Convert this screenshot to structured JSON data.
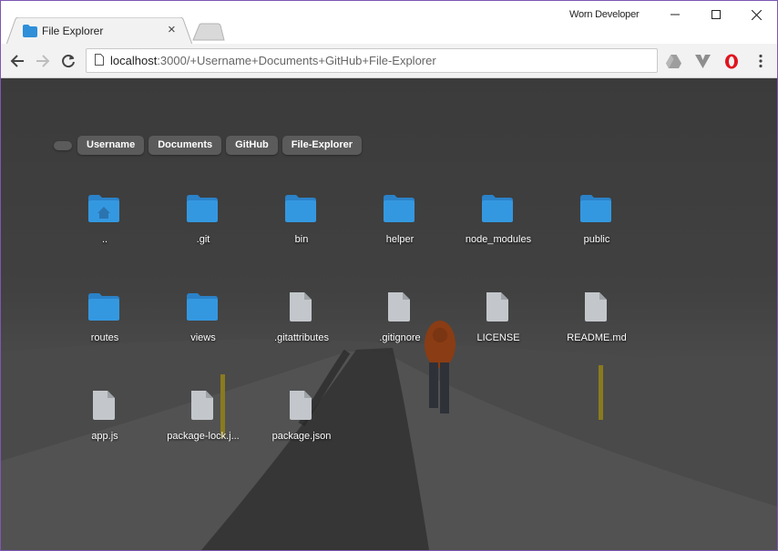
{
  "browser": {
    "tab_title": "File Explorer",
    "tab_close": "×",
    "profile_name": "Worn Developer",
    "url_host": "localhost",
    "url_rest": ":3000/+Username+Documents+GitHub+File-Explorer",
    "accent_color": "#2f8fd8"
  },
  "breadcrumb": {
    "root_label": "",
    "items": [
      "Username",
      "Documents",
      "GitHub",
      "File-Explorer"
    ]
  },
  "files": [
    {
      "name": "..",
      "type": "folder-home"
    },
    {
      "name": ".git",
      "type": "folder"
    },
    {
      "name": "bin",
      "type": "folder"
    },
    {
      "name": "helper",
      "type": "folder"
    },
    {
      "name": "node_modules",
      "type": "folder"
    },
    {
      "name": "public",
      "type": "folder"
    },
    {
      "name": "routes",
      "type": "folder"
    },
    {
      "name": "views",
      "type": "folder"
    },
    {
      "name": ".gitattributes",
      "type": "file"
    },
    {
      "name": ".gitignore",
      "type": "file"
    },
    {
      "name": "LICENSE",
      "type": "file"
    },
    {
      "name": "README.md",
      "type": "file"
    },
    {
      "name": "app.js",
      "type": "file"
    },
    {
      "name": "package-lock.j...",
      "type": "file"
    },
    {
      "name": "package.json",
      "type": "file"
    }
  ]
}
